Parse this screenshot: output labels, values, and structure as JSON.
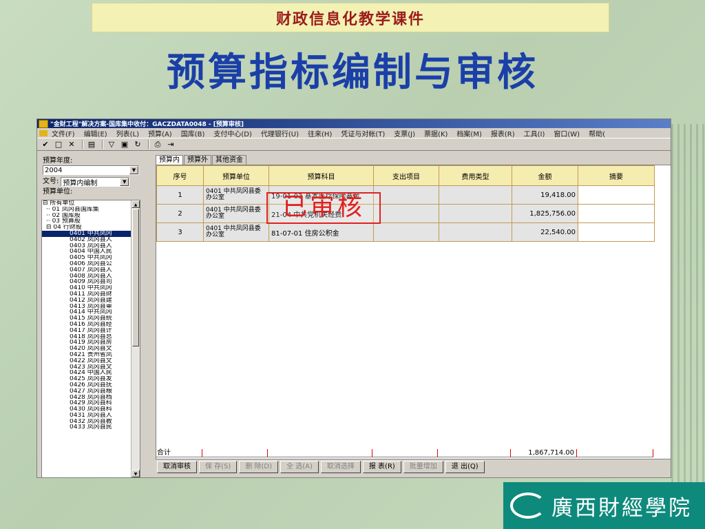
{
  "banner": "财政信息化教学课件",
  "main_title": "预算指标编制与审核",
  "window": {
    "title": "\"金财工程\"解决方案-国库集中收付：GACZDATA0048 - [预算审核]",
    "menu": [
      "文件(F)",
      "编辑(E)",
      "列表(L)",
      "预算(A)",
      "国库(B)",
      "支付中心(D)",
      "代理银行(U)",
      "往来(H)",
      "凭证与对帐(T)",
      "支票(J)",
      "票据(K)",
      "档案(M)",
      "报表(R)",
      "工具(I)",
      "窗口(W)",
      "帮助("
    ],
    "toolbar_icons": [
      "check-edit-icon",
      "new-doc-icon",
      "delete-icon",
      "save-icon",
      "filter-icon",
      "print-preview-icon",
      "refresh-icon",
      "print-icon",
      "exit-icon"
    ]
  },
  "left": {
    "year_label": "预算年度:",
    "year_value": "2004",
    "doc_label": "文号:",
    "doc_value": "预算内编制",
    "unit_label": "预算单位:",
    "tree": [
      {
        "text": "⊟ 所有单位",
        "indent": 0
      },
      {
        "text": "·· 01 凤冈县国库集",
        "indent": 1
      },
      {
        "text": "·· 02 国库股",
        "indent": 1
      },
      {
        "text": "·· 03 预算股",
        "indent": 1
      },
      {
        "text": "⊟ 04 行财股",
        "indent": 1
      },
      {
        "text": "0401 中共凤冈",
        "indent": 2,
        "selected": true
      },
      {
        "text": "0402 凤冈县人",
        "indent": 2
      },
      {
        "text": "0403 凤冈县人",
        "indent": 2
      },
      {
        "text": "0404 中国人民",
        "indent": 2
      },
      {
        "text": "0405 中共凤冈",
        "indent": 2
      },
      {
        "text": "0406 凤冈县公",
        "indent": 2
      },
      {
        "text": "0407 凤冈县人",
        "indent": 2
      },
      {
        "text": "0408 凤冈县人",
        "indent": 2
      },
      {
        "text": "0409 凤冈县司",
        "indent": 2
      },
      {
        "text": "0410 中共凤冈",
        "indent": 2
      },
      {
        "text": "0411 凤冈县财",
        "indent": 2
      },
      {
        "text": "0412 凤冈县建",
        "indent": 2
      },
      {
        "text": "0413 凤冈县审",
        "indent": 2
      },
      {
        "text": "0414 中共凤冈",
        "indent": 2
      },
      {
        "text": "0415 凤冈县统",
        "indent": 2
      },
      {
        "text": "0416 凤冈县经",
        "indent": 2
      },
      {
        "text": "0417 凤冈县计",
        "indent": 2
      },
      {
        "text": "0418 凤冈县总",
        "indent": 2
      },
      {
        "text": "0419 凤冈县房",
        "indent": 2
      },
      {
        "text": "0420 凤冈县文",
        "indent": 2
      },
      {
        "text": "0421 贵州省凤",
        "indent": 2
      },
      {
        "text": "0422 凤冈县文",
        "indent": 2
      },
      {
        "text": "0423 凤冈县文",
        "indent": 2
      },
      {
        "text": "0424 中国人民",
        "indent": 2
      },
      {
        "text": "0425 凤冈县发",
        "indent": 2
      },
      {
        "text": "0426 凤冈县抚",
        "indent": 2
      },
      {
        "text": "0427 凤冈县粮",
        "indent": 2
      },
      {
        "text": "0428 凤冈县档",
        "indent": 2
      },
      {
        "text": "0429 凤冈县科",
        "indent": 2
      },
      {
        "text": "0430 凤冈县科",
        "indent": 2
      },
      {
        "text": "0431 凤冈县人",
        "indent": 2
      },
      {
        "text": "0432 凤冈县教",
        "indent": 2
      },
      {
        "text": "0433 凤冈县民",
        "indent": 2
      }
    ]
  },
  "tabs": [
    "预算内",
    "预算外",
    "其他资金"
  ],
  "table": {
    "headers": [
      "序号",
      "预算单位",
      "预算科目",
      "支出项目",
      "费用类型",
      "金额",
      "摘要"
    ],
    "rows": [
      {
        "seq": "1",
        "unit": "0401 中共凤冈县委办公室",
        "subject": "19-01-03 基本医疗保险基金",
        "item": "",
        "type": "",
        "amount": "19,418.00",
        "note": ""
      },
      {
        "seq": "2",
        "unit": "0401 中共凤冈县委办公室",
        "subject": "21-04 中共党机关经费",
        "item": "",
        "type": "",
        "amount": "1,825,756.00",
        "note": ""
      },
      {
        "seq": "3",
        "unit": "0401 中共凤冈县委办公室",
        "subject": "81-07-01 住房公积金",
        "item": "",
        "type": "",
        "amount": "22,540.00",
        "note": ""
      }
    ],
    "total_label": "合计",
    "total_amount": "1,867,714.00"
  },
  "stamp": "已审核",
  "buttons": [
    {
      "label": "取消审核",
      "enabled": true
    },
    {
      "label": "保 存(S)",
      "enabled": false
    },
    {
      "label": "删 除(D)",
      "enabled": false
    },
    {
      "label": "全 选(A)",
      "enabled": false
    },
    {
      "label": "取消选择",
      "enabled": false
    },
    {
      "label": "报 表(R)",
      "enabled": true
    },
    {
      "label": "批量增加",
      "enabled": false
    },
    {
      "label": "退 出(Q)",
      "enabled": true
    }
  ],
  "logo_text": "廣西財經學院"
}
